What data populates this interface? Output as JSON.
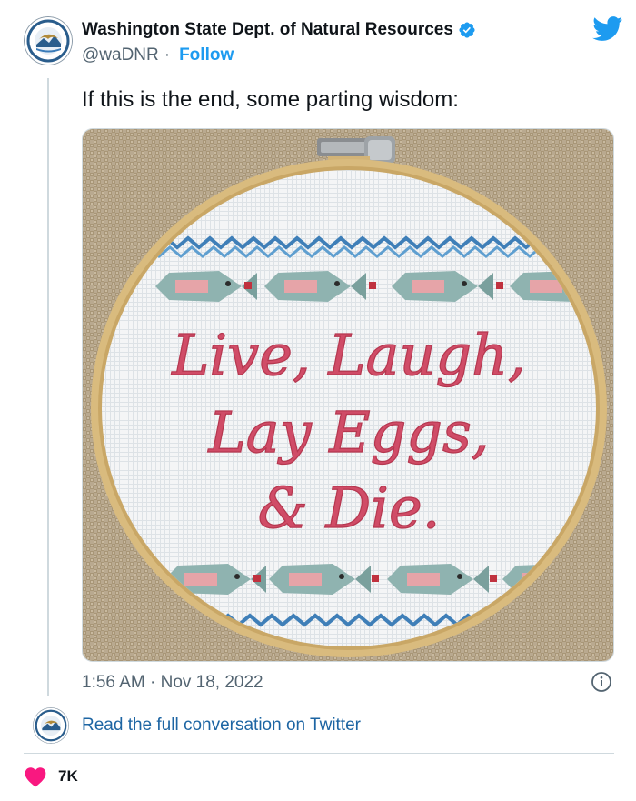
{
  "author": {
    "name": "Washington State Dept. of Natural Resources",
    "handle": "@waDNR",
    "separator": "·",
    "follow_label": "Follow"
  },
  "tweet": {
    "text": "If this is the end, some parting wisdom:",
    "timestamp": "1:56 AM · Nov 18, 2022"
  },
  "media": {
    "embroidery_lines": [
      "Live, Laugh,",
      "Lay Eggs,",
      "& Die."
    ]
  },
  "footer": {
    "read_link": "Read the full conversation on Twitter",
    "like_count": "7K"
  },
  "colors": {
    "twitter_blue": "#1d9bf0",
    "link_blue": "#1d65a3",
    "heart": "#f91880",
    "muted": "#536471",
    "thread": "#cfd9de"
  },
  "icons": [
    "verified-badge-icon",
    "twitter-bird-icon",
    "info-icon",
    "heart-icon"
  ]
}
